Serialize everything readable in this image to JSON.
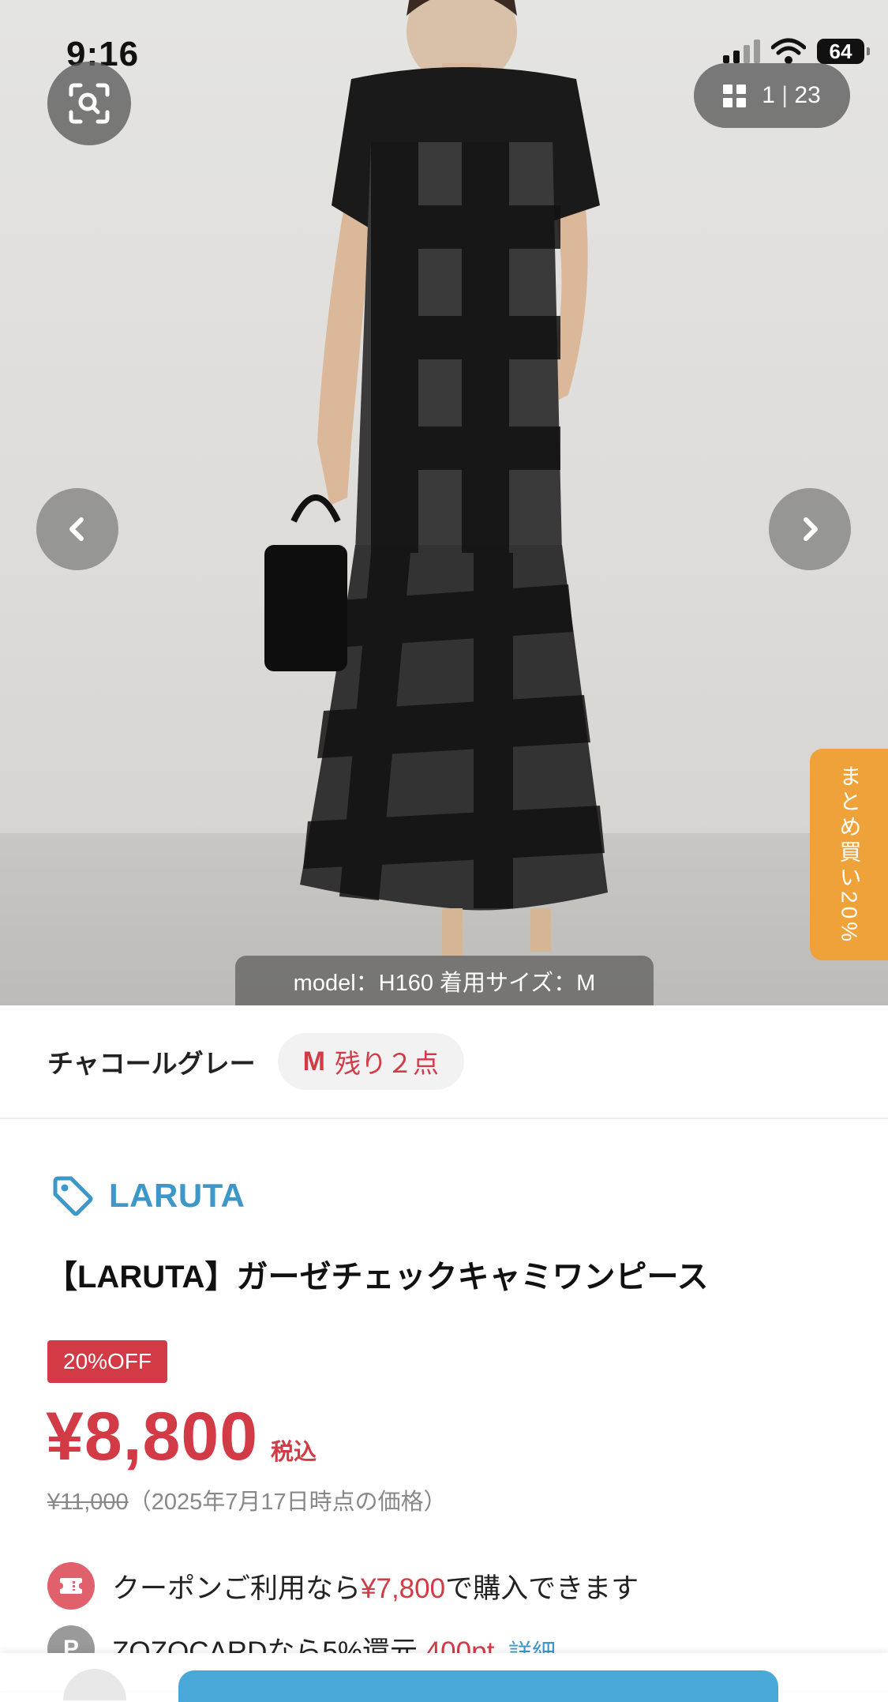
{
  "status_bar": {
    "time": "9:16",
    "battery": "64"
  },
  "gallery": {
    "current": "1",
    "separator": "|",
    "total": "23",
    "model_caption": "model：H160 着用サイズ：M",
    "bulk_tab_label": "まとめ買い20%"
  },
  "variant": {
    "color": "チャコールグレー",
    "size": "M",
    "stock": "残り２点"
  },
  "product": {
    "brand": "LARUTA",
    "title": "【LARUTA】ガーゼチェックキャミワンピース",
    "discount_badge": "20%OFF",
    "price": "¥8,800",
    "tax_label": "税込",
    "original_price": "¥11,000",
    "original_note": "（2025年7月17日時点の価格）"
  },
  "coupon": {
    "prefix": "クーポンご利用なら",
    "price": "¥7,800",
    "suffix": "で購入できます"
  },
  "zozocard": {
    "icon_letter": "P",
    "text": "ZOZOCARDなら5%還元",
    "points": "400pt",
    "detail_link": "詳細"
  },
  "colors": {
    "accent_red": "#d23a46",
    "brand_blue": "#3d97c9",
    "bulk_orange": "#f0a23a"
  },
  "icons": [
    "image-search-icon",
    "grid-icon",
    "chevron-left-icon",
    "chevron-right-icon",
    "tag-icon",
    "coupon-ticket-icon",
    "points-icon"
  ]
}
